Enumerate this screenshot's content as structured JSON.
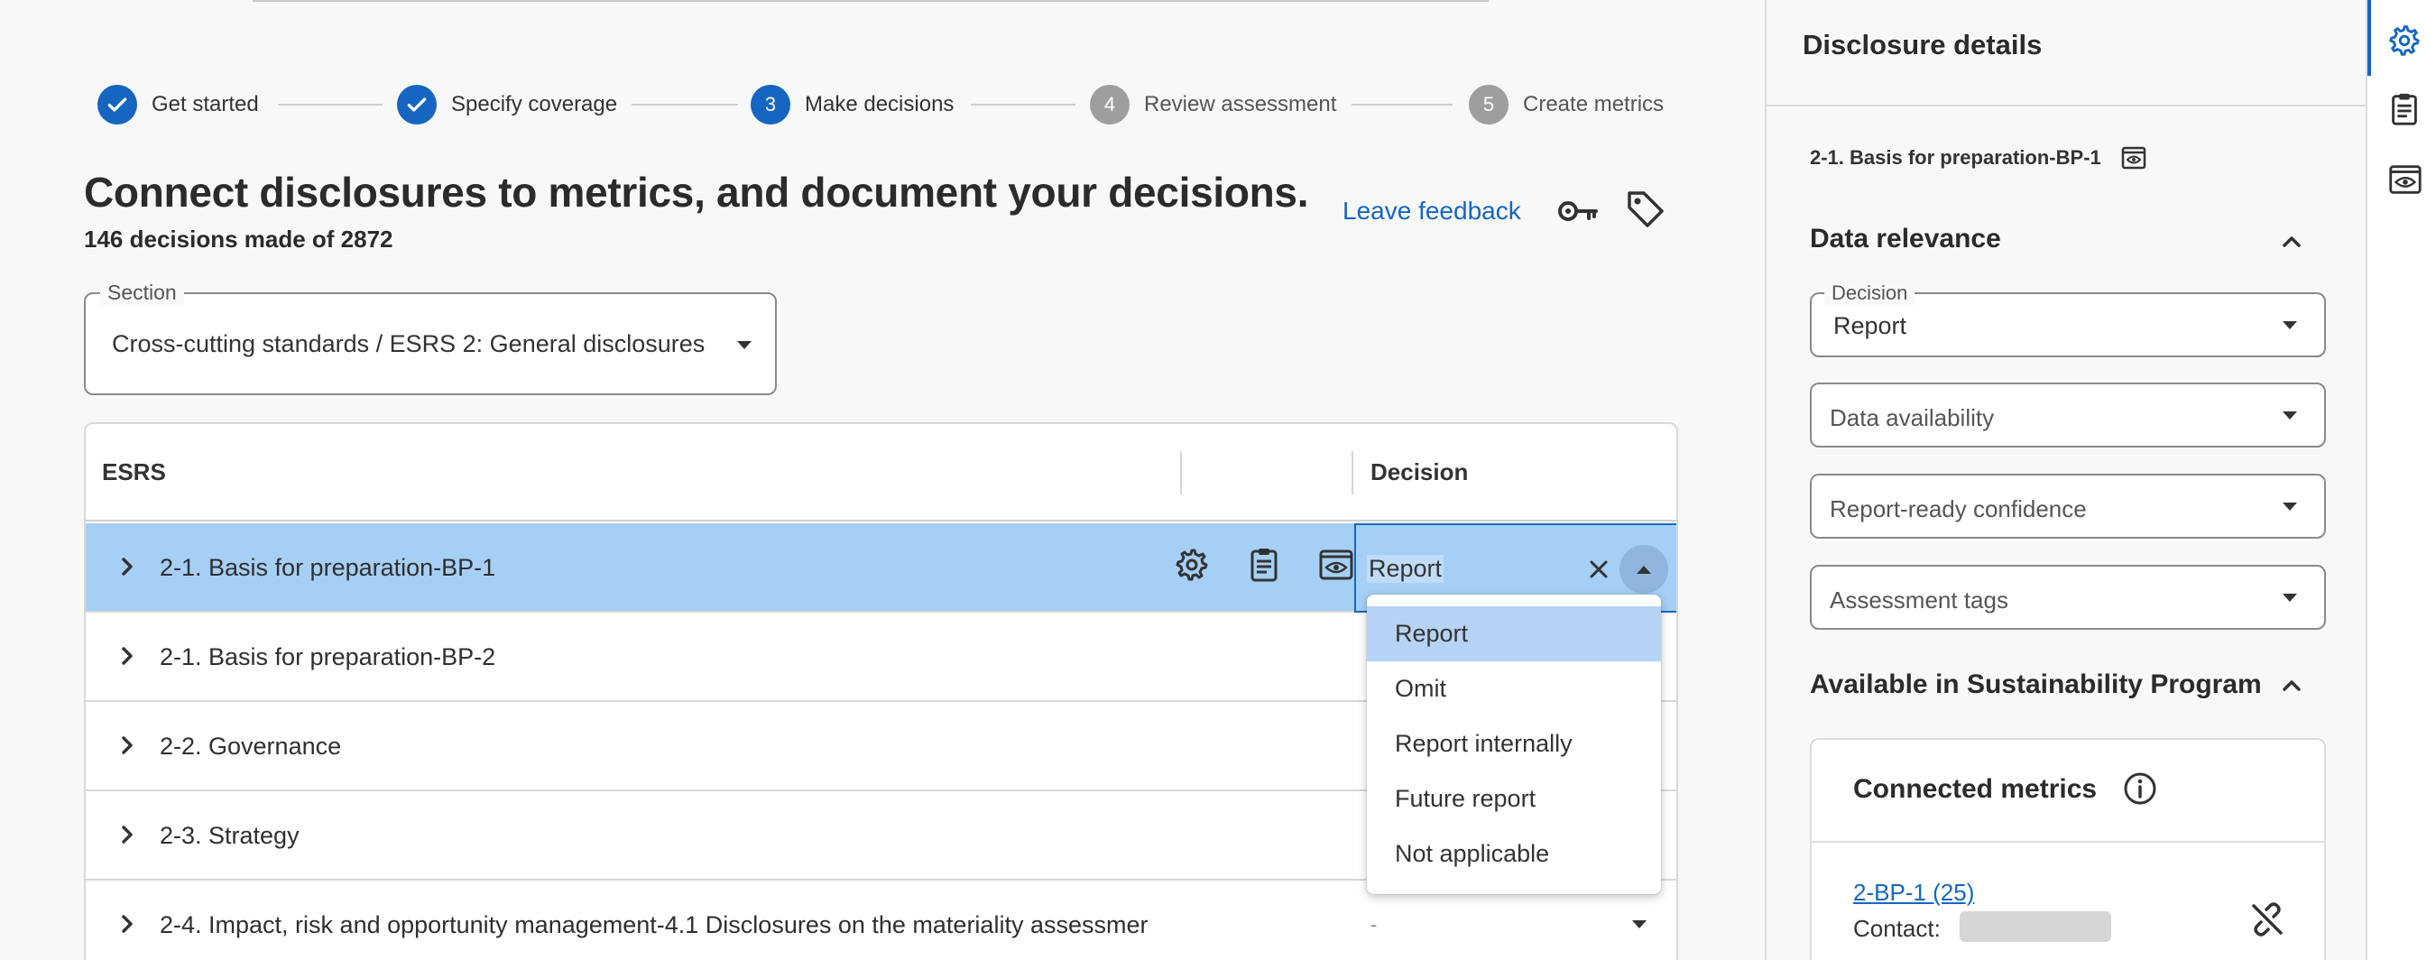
{
  "stepper": {
    "steps": [
      {
        "label": "Get started",
        "number": "",
        "state": "done"
      },
      {
        "label": "Specify coverage",
        "number": "",
        "state": "done"
      },
      {
        "label": "Make decisions",
        "number": "3",
        "state": "current"
      },
      {
        "label": "Review assessment",
        "number": "4",
        "state": "todo"
      },
      {
        "label": "Create metrics",
        "number": "5",
        "state": "todo"
      }
    ]
  },
  "header": {
    "title": "Connect disclosures to metrics, and document your decisions.",
    "subtitle": "146 decisions made of 2872",
    "feedback_link": "Leave feedback"
  },
  "section_select": {
    "legend": "Section",
    "value": "Cross-cutting standards / ESRS 2: General disclosures"
  },
  "table": {
    "columns": [
      "ESRS",
      "",
      "Decision"
    ],
    "rows": [
      {
        "label": "2-1. Basis for preparation-BP-1",
        "decision": "Report",
        "selected": true
      },
      {
        "label": "2-1. Basis for preparation-BP-2",
        "decision": "",
        "selected": false
      },
      {
        "label": "2-2. Governance",
        "decision": "",
        "selected": false
      },
      {
        "label": "2-3. Strategy",
        "decision": "",
        "selected": false
      },
      {
        "label": "2-4. Impact, risk and opportunity management-4.1 Disclosures on the materiality assessmer",
        "decision": "-",
        "selected": false
      }
    ]
  },
  "decision_dropdown": {
    "options": [
      "Report",
      "Omit",
      "Report internally",
      "Future report",
      "Not applicable"
    ],
    "active_index": 0
  },
  "panel": {
    "title": "Disclosure details",
    "disclosure_ref": "2-1. Basis for preparation-BP-1",
    "data_relevance": {
      "heading": "Data relevance",
      "decision_legend": "Decision",
      "decision_value": "Report",
      "data_availability_placeholder": "Data availability",
      "confidence_placeholder": "Report-ready confidence",
      "tags_placeholder": "Assessment tags"
    },
    "program": {
      "heading": "Available in Sustainability Program",
      "connected_metrics_title": "Connected metrics",
      "metric_link": "2-BP-1 (25)",
      "contact_label": "Contact:"
    }
  },
  "colors": {
    "accent": "#1566c0",
    "selected_row": "#a6cff5",
    "option_highlight": "#b5d3f4",
    "inactive_step": "#9e9e9e"
  },
  "icons": {
    "rail": [
      "gear-icon",
      "clipboard-icon",
      "preview-icon"
    ]
  }
}
